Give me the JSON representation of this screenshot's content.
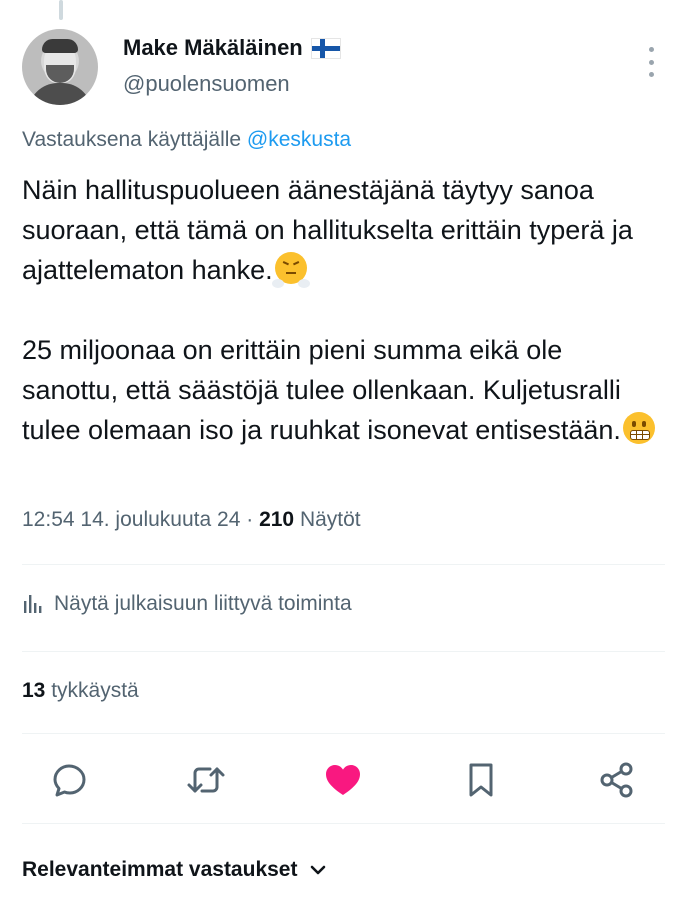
{
  "author": {
    "display_name": "Make Mäkäläinen",
    "handle": "@puolensuomen"
  },
  "reply_context": {
    "prefix": "Vastauksena käyttäjälle",
    "mention": "@keskusta"
  },
  "tweet": {
    "paragraph1": "Näin hallituspuolueen äänestäjänä täytyy sanoa suoraan, että tämä on hallitukselta erittäin typerä ja ajattelematon hanke.",
    "paragraph2": "25 miljoonaa on erittäin pieni summa eikä ole sanottu, että säästöjä tulee ollenkaan. Kuljetusralli tulee olemaan iso ja ruuhkat isonevat entisestään."
  },
  "meta": {
    "time": "12:54",
    "date": "14. joulukuuta 24",
    "separator": "·",
    "views_count": "210",
    "views_label": "Näytöt"
  },
  "analytics_link": "Näytä julkaisuun liittyvä toiminta",
  "likes": {
    "count": "13",
    "label": "tykkäystä"
  },
  "actions": {
    "reply_icon": "reply-icon",
    "retweet_icon": "retweet-icon",
    "like_icon": "heart-icon",
    "like_color": "#f91880",
    "bookmark_icon": "bookmark-icon",
    "share_icon": "share-icon"
  },
  "replies_sort": {
    "label": "Relevanteimmat vastaukset"
  },
  "colors": {
    "accent": "#1d9bf0",
    "secondary_text": "#536471",
    "primary_text": "#0f1419"
  }
}
